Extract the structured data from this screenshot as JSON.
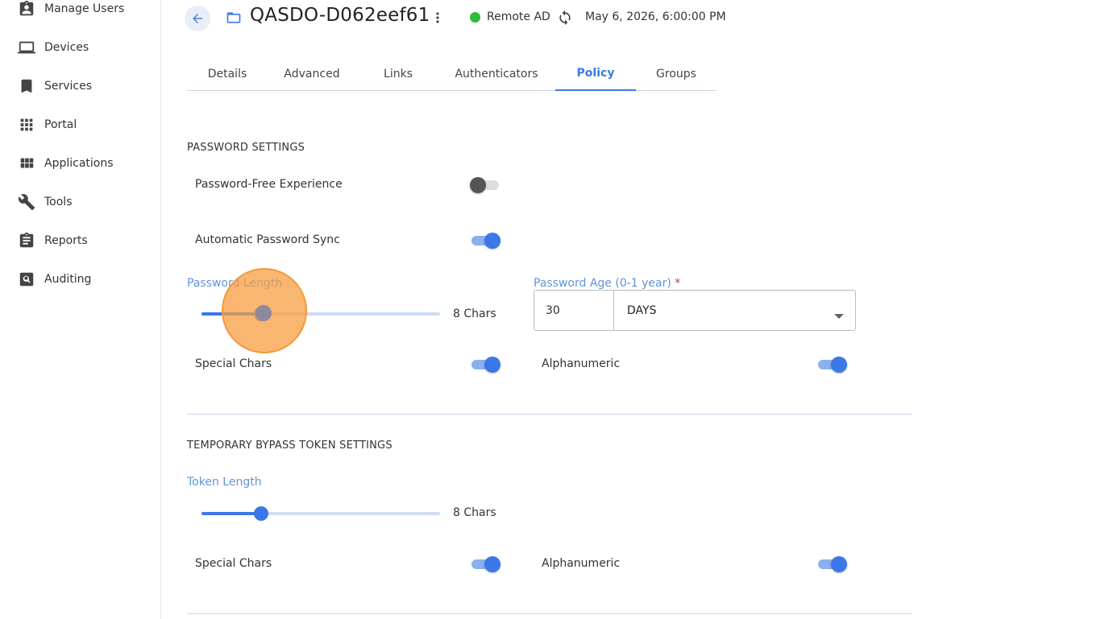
{
  "sidebar": {
    "items": [
      {
        "label": "Manage Users",
        "icon": "user-badge-icon"
      },
      {
        "label": "Devices",
        "icon": "laptop-icon"
      },
      {
        "label": "Services",
        "icon": "bookmark-icon"
      },
      {
        "label": "Portal",
        "icon": "grid-icon"
      },
      {
        "label": "Applications",
        "icon": "apps-icon"
      },
      {
        "label": "Tools",
        "icon": "wrench-icon"
      },
      {
        "label": "Reports",
        "icon": "clipboard-icon"
      },
      {
        "label": "Auditing",
        "icon": "search-box-icon"
      }
    ]
  },
  "header": {
    "title": "QASDO-D062eef61",
    "status_text": "Remote AD",
    "status_color": "#2dbb3a",
    "timestamp": "May 6, 2026, 6:00:00 PM"
  },
  "tabs": [
    {
      "label": "Details",
      "active": false
    },
    {
      "label": "Advanced",
      "active": false
    },
    {
      "label": "Links",
      "active": false
    },
    {
      "label": "Authenticators",
      "active": false
    },
    {
      "label": "Policy",
      "active": true
    },
    {
      "label": "Groups",
      "active": false
    }
  ],
  "password_settings": {
    "title": "PASSWORD SETTINGS",
    "password_free_label": "Password-Free Experience",
    "password_free_on": false,
    "auto_sync_label": "Automatic Password Sync",
    "auto_sync_on": true,
    "length_label": "Password Length",
    "length_value_text": "8 Chars",
    "length_fraction": 0.25,
    "age_label": "Password Age (0-1 year)",
    "age_required": "*",
    "age_value": "30",
    "age_unit": "DAYS",
    "special_chars_label": "Special Chars",
    "special_chars_on": true,
    "alphanumeric_label": "Alphanumeric",
    "alphanumeric_on": true
  },
  "token_settings": {
    "title": "TEMPORARY BYPASS TOKEN SETTINGS",
    "length_label": "Token Length",
    "length_value_text": "8 Chars",
    "length_fraction": 0.25,
    "special_chars_label": "Special Chars",
    "special_chars_on": true,
    "alphanumeric_label": "Alphanumeric",
    "alphanumeric_on": true
  },
  "colors": {
    "accent": "#3b78e7",
    "label_blue": "#5e96d8",
    "highlight": "#f39a3a"
  }
}
